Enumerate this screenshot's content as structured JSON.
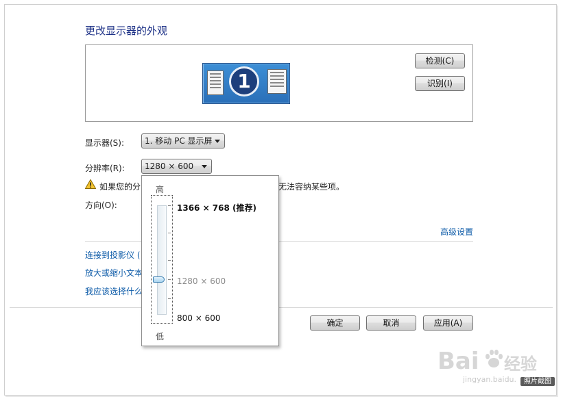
{
  "dialog": {
    "title": "更改显示器的外观",
    "detect_label": "检测(C)",
    "identify_label": "识别(I)",
    "monitor_number": "1"
  },
  "settings": {
    "display_label": "显示器(S):",
    "display_value": "1. 移动 PC 显示屏",
    "resolution_label": "分辨率(R):",
    "resolution_value": "1280 × 600",
    "warning_prefix": "如果您的分",
    "warning_suffix": "无法容纳某些项。",
    "orientation_label": "方向(O):",
    "advanced_link": "高级设置"
  },
  "links": [
    "连接到投影仪 (",
    "放大或缩小文本",
    "我应该选择什么"
  ],
  "resolution_popup": {
    "high_label": "高",
    "low_label": "低",
    "options": [
      {
        "label": "1366 × 768 (推荐)"
      },
      {
        "label": "1280 × 600"
      },
      {
        "label": "800 × 600"
      }
    ],
    "selected_index": 1
  },
  "footer": {
    "ok_label": "确定",
    "cancel_label": "取消",
    "apply_label": "应用(A)"
  },
  "watermark": {
    "brand": "Bai",
    "brand_cn": "经验",
    "url": "jingyan.baidu.",
    "tag": "照片截图"
  },
  "colors": {
    "title": "#1e3287",
    "link": "#0d5ba8",
    "accent": "#2a6fb8"
  }
}
